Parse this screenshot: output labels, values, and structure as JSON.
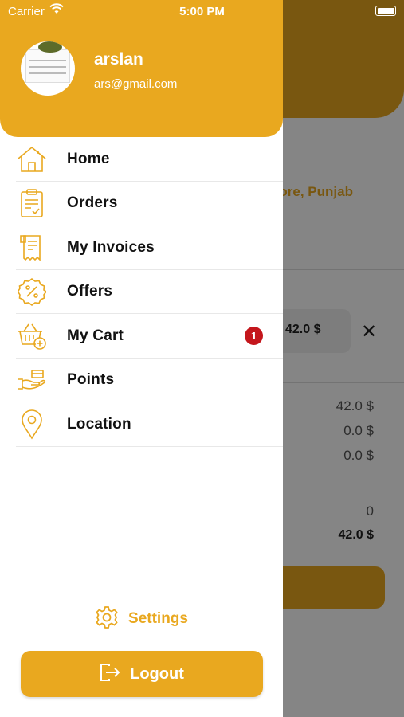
{
  "status_bar": {
    "carrier": "Carrier",
    "time": "5:00 PM"
  },
  "background": {
    "address": "hore, Punjab",
    "item_price": "42.0 $",
    "close_symbol": "✕",
    "summary": [
      "42.0 $",
      "0.0 $",
      "0.0 $",
      "0",
      "42.0 $"
    ]
  },
  "drawer": {
    "user": {
      "name": "arslan",
      "email": "ars@gmail.com"
    },
    "menu": [
      {
        "label": "Home",
        "icon": "home-icon"
      },
      {
        "label": "Orders",
        "icon": "clipboard-icon"
      },
      {
        "label": "My Invoices",
        "icon": "receipt-icon"
      },
      {
        "label": "Offers",
        "icon": "percent-badge-icon"
      },
      {
        "label": "My Cart",
        "icon": "basket-add-icon",
        "badge": "1"
      },
      {
        "label": "Points",
        "icon": "hand-card-icon"
      },
      {
        "label": "Location",
        "icon": "location-pin-icon"
      }
    ],
    "settings_label": "Settings",
    "logout_label": "Logout"
  },
  "colors": {
    "accent": "#e9a81f",
    "badge": "#c4161c",
    "text": "#111111"
  }
}
